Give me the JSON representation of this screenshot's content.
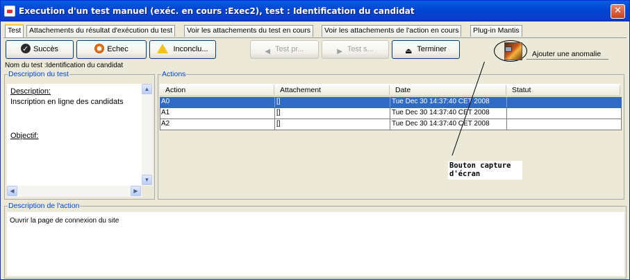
{
  "window": {
    "title": "Execution d'un test manuel (exéc. en cours :Exec2), test : Identification du candidat",
    "close_icon": "close-icon"
  },
  "tabs": [
    {
      "label": "Test",
      "active": true
    },
    {
      "label": "Attachements du résultat d'exécution du test",
      "active": false
    },
    {
      "label": "Voir les attachements du test en cours",
      "active": false
    },
    {
      "label": "Voir les attachements de l'action en cours",
      "active": false
    },
    {
      "label": "Plug-in Mantis",
      "active": false
    }
  ],
  "toolbar": {
    "success_label": "Succès",
    "fail_label": "Echec",
    "inconclusive_label": "Inconclu...",
    "prev_label": "Test pr...",
    "next_label": "Test s...",
    "finish_label": "Terminer",
    "anomaly_label": "Ajouter une anomalie"
  },
  "test_name": "Nom du test :Identification du candidat",
  "test_description": {
    "title": "Description du test",
    "description_heading": "Description:",
    "description_text": "Inscription en ligne des candidats",
    "objective_heading": "Objectif:"
  },
  "actions": {
    "title": "Actions",
    "columns": [
      "Action",
      "Attachement",
      "Date",
      "Statut"
    ],
    "rows": [
      {
        "action": "A0",
        "attachment": "[]",
        "date": "Tue Dec 30 14:37:40 CET 2008",
        "status": "",
        "selected": true
      },
      {
        "action": "A1",
        "attachment": "[]",
        "date": "Tue Dec 30 14:37:40 CET 2008",
        "status": "",
        "selected": false
      },
      {
        "action": "A2",
        "attachment": "[]",
        "date": "Tue Dec 30 14:37:40 CET 2008",
        "status": "",
        "selected": false
      }
    ]
  },
  "callout": {
    "line1": "Bouton capture",
    "line2": "d'écran"
  },
  "action_description": {
    "title": "Description de l'action",
    "text": "Ouvrir la page de connexion du site"
  },
  "colors": {
    "title_bar": "#0046d5",
    "selection": "#316ac5",
    "group_title": "#0046d5",
    "active_tab_accent": "#ffc83c"
  }
}
